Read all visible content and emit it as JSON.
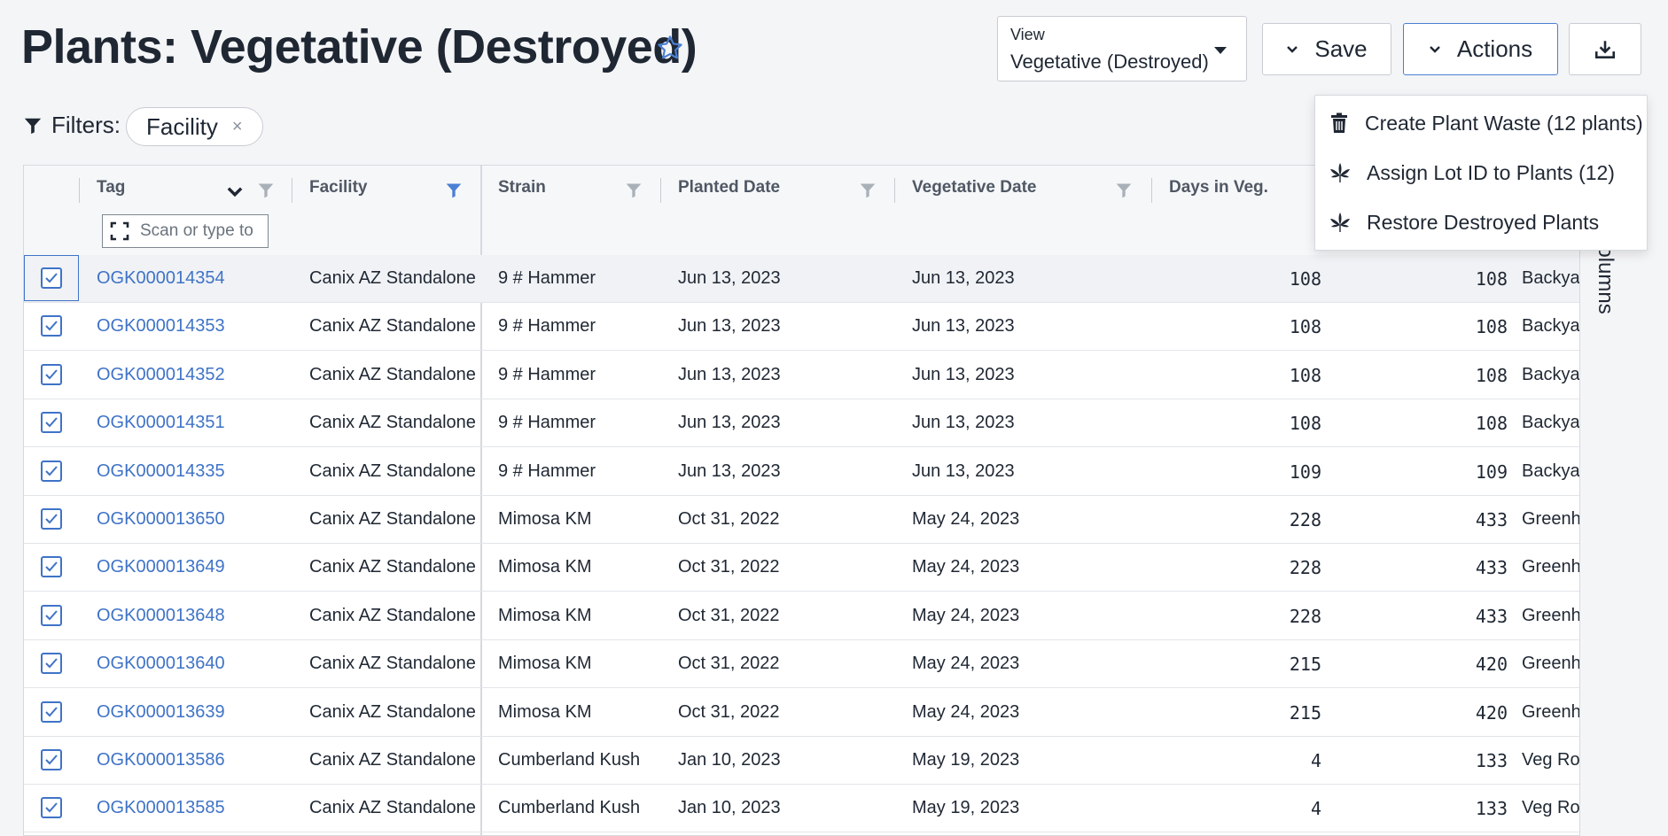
{
  "header": {
    "title": "Plants: Vegetative (Destroyed)",
    "view_label": "View",
    "view_value": "Vegetative (Destroyed)",
    "save_label": "Save",
    "actions_label": "Actions"
  },
  "filters": {
    "label": "Filters:",
    "chips": [
      {
        "label": "Facility",
        "remove": "×"
      }
    ]
  },
  "columns": {
    "tag": "Tag",
    "facility": "Facility",
    "strain": "Strain",
    "planted": "Planted Date",
    "vegetative": "Vegetative Date",
    "days_veg": "Days in Veg."
  },
  "scan_placeholder": "Scan or type to",
  "sidebar_label": "Columns",
  "menu": {
    "items": [
      {
        "label": "Create Plant Waste (12 plants)",
        "icon": "trash-icon"
      },
      {
        "label": "Assign Lot ID to Plants (12)",
        "icon": "cannabis-leaf-icon"
      },
      {
        "label": "Restore Destroyed Plants",
        "icon": "cannabis-leaf-icon"
      }
    ]
  },
  "rows": [
    {
      "tag": "OGK000014354",
      "facility": "Canix AZ Standalone",
      "strain": "9 # Hammer",
      "planted": "Jun 13, 2023",
      "veg": "Jun 13, 2023",
      "days_veg": "108",
      "days_total": "108",
      "location": "Backyard"
    },
    {
      "tag": "OGK000014353",
      "facility": "Canix AZ Standalone",
      "strain": "9 # Hammer",
      "planted": "Jun 13, 2023",
      "veg": "Jun 13, 2023",
      "days_veg": "108",
      "days_total": "108",
      "location": "Backyard"
    },
    {
      "tag": "OGK000014352",
      "facility": "Canix AZ Standalone",
      "strain": "9 # Hammer",
      "planted": "Jun 13, 2023",
      "veg": "Jun 13, 2023",
      "days_veg": "108",
      "days_total": "108",
      "location": "Backyard"
    },
    {
      "tag": "OGK000014351",
      "facility": "Canix AZ Standalone",
      "strain": "9 # Hammer",
      "planted": "Jun 13, 2023",
      "veg": "Jun 13, 2023",
      "days_veg": "108",
      "days_total": "108",
      "location": "Backyard"
    },
    {
      "tag": "OGK000014335",
      "facility": "Canix AZ Standalone",
      "strain": "9 # Hammer",
      "planted": "Jun 13, 2023",
      "veg": "Jun 13, 2023",
      "days_veg": "109",
      "days_total": "109",
      "location": "Backyard"
    },
    {
      "tag": "OGK000013650",
      "facility": "Canix AZ Standalone",
      "strain": "Mimosa KM",
      "planted": "Oct 31, 2022",
      "veg": "May 24, 2023",
      "days_veg": "228",
      "days_total": "433",
      "location": "Greenhouse"
    },
    {
      "tag": "OGK000013649",
      "facility": "Canix AZ Standalone",
      "strain": "Mimosa KM",
      "planted": "Oct 31, 2022",
      "veg": "May 24, 2023",
      "days_veg": "228",
      "days_total": "433",
      "location": "Greenhouse"
    },
    {
      "tag": "OGK000013648",
      "facility": "Canix AZ Standalone",
      "strain": "Mimosa KM",
      "planted": "Oct 31, 2022",
      "veg": "May 24, 2023",
      "days_veg": "228",
      "days_total": "433",
      "location": "Greenhouse"
    },
    {
      "tag": "OGK000013640",
      "facility": "Canix AZ Standalone",
      "strain": "Mimosa KM",
      "planted": "Oct 31, 2022",
      "veg": "May 24, 2023",
      "days_veg": "215",
      "days_total": "420",
      "location": "Greenhouse"
    },
    {
      "tag": "OGK000013639",
      "facility": "Canix AZ Standalone",
      "strain": "Mimosa KM",
      "planted": "Oct 31, 2022",
      "veg": "May 24, 2023",
      "days_veg": "215",
      "days_total": "420",
      "location": "Greenhouse"
    },
    {
      "tag": "OGK000013586",
      "facility": "Canix AZ Standalone",
      "strain": "Cumberland Kush",
      "planted": "Jan 10, 2023",
      "veg": "May 19, 2023",
      "days_veg": "4",
      "days_total": "133",
      "location": "Veg Room"
    },
    {
      "tag": "OGK000013585",
      "facility": "Canix AZ Standalone",
      "strain": "Cumberland Kush",
      "planted": "Jan 10, 2023",
      "veg": "May 19, 2023",
      "days_veg": "4",
      "days_total": "133",
      "location": "Veg Room"
    }
  ],
  "colors": {
    "accent": "#3f73c7",
    "text": "#1f2733",
    "active_filter": "#4a7fd4"
  }
}
